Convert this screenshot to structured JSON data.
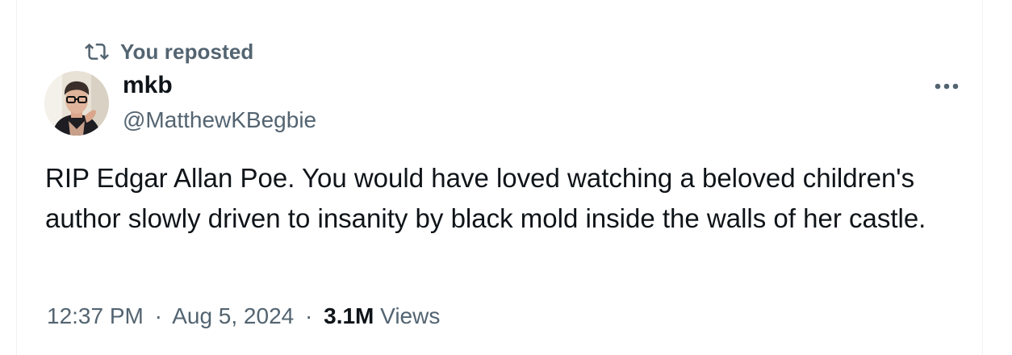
{
  "repost": {
    "label": "You reposted",
    "icon": "repost-icon"
  },
  "author": {
    "name": "mkb",
    "handle": "@MatthewKBegbie",
    "avatar_icon": "avatar"
  },
  "more_icon": "more-icon",
  "tweet": {
    "text": "RIP Edgar Allan Poe. You would have loved watching a beloved children's author slowly driven to insanity by black mold inside the walls of her castle."
  },
  "meta": {
    "time": "12:37 PM",
    "separator": "·",
    "date": "Aug 5, 2024",
    "views_count": "3.1M",
    "views_label": "Views"
  },
  "colors": {
    "text_primary": "#0f1419",
    "text_secondary": "#536471",
    "border": "#eff3f4"
  }
}
